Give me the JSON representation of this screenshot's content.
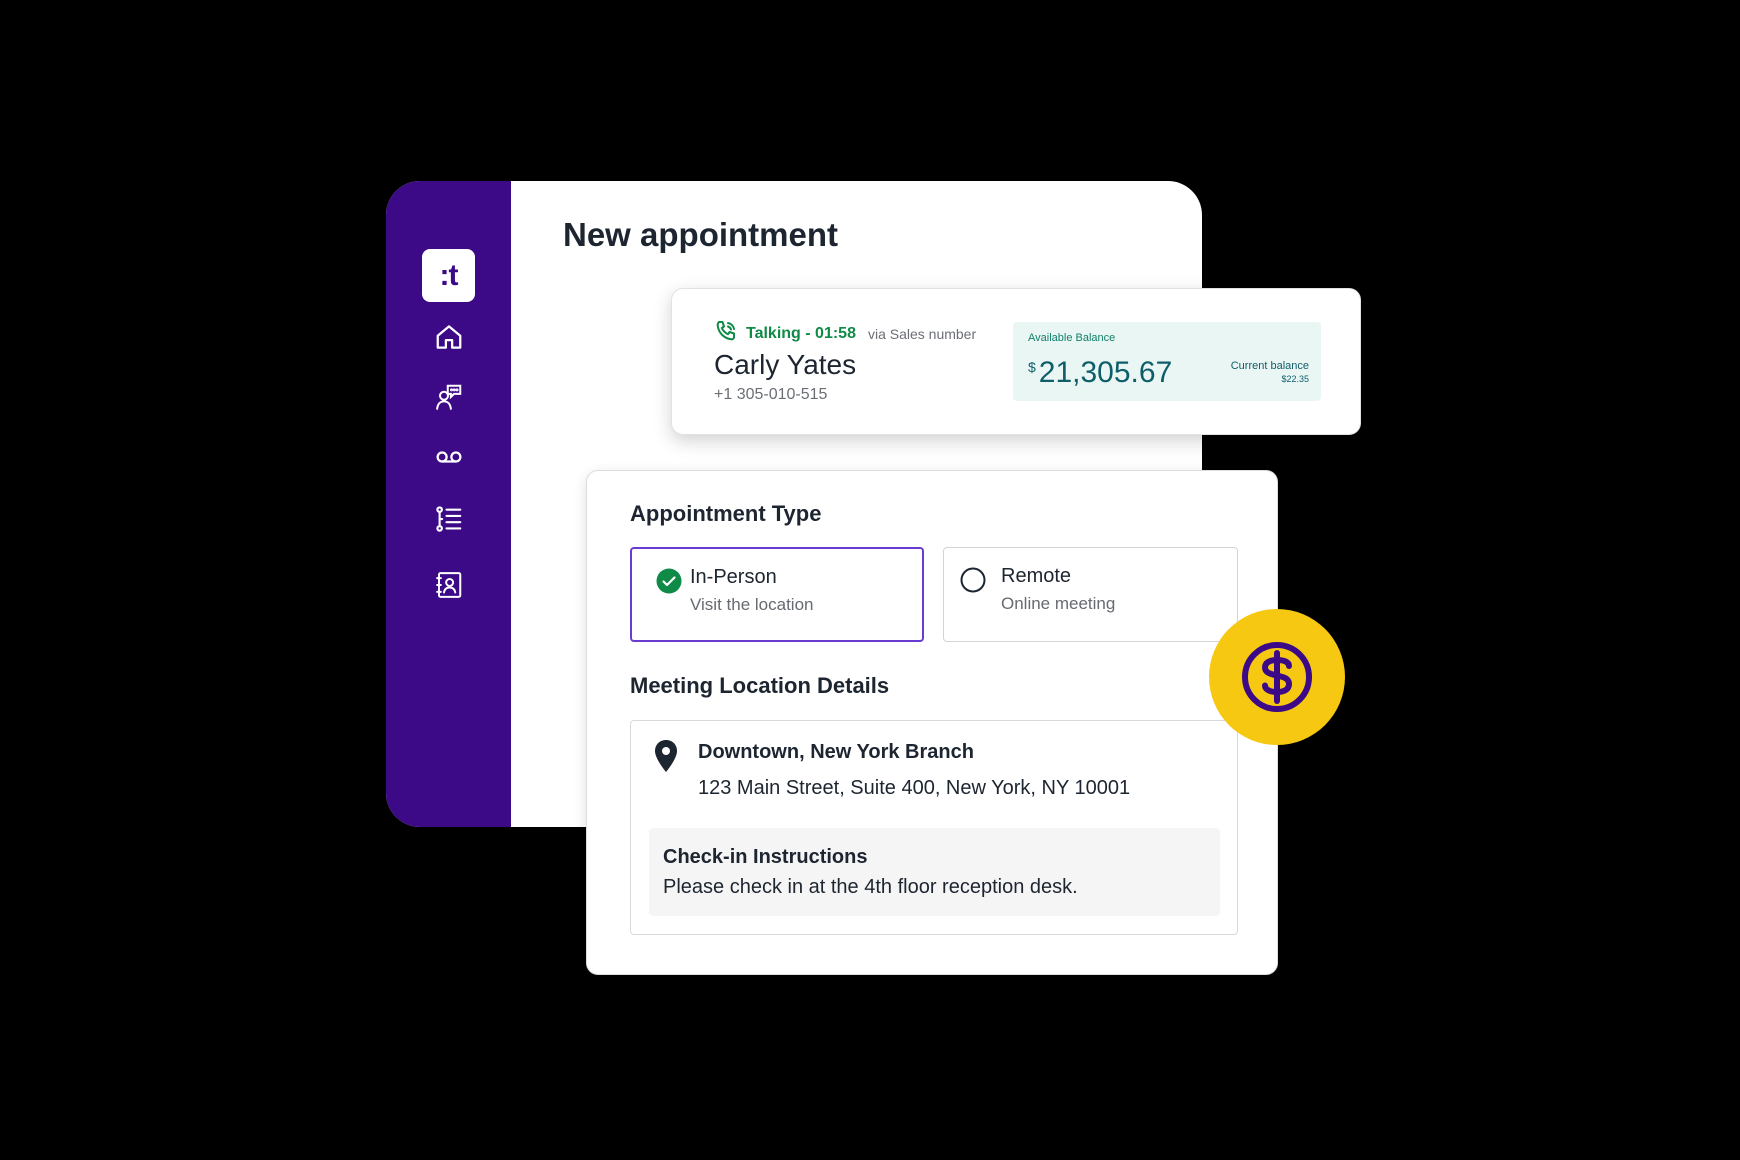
{
  "app": {
    "logo_text": ":t",
    "page_title": "New appointment",
    "nav_icons": [
      "home-icon",
      "contacts-chat-icon",
      "voicemail-icon",
      "list-icon",
      "address-book-icon"
    ]
  },
  "call": {
    "status": "Talking - 01:58",
    "via": "via Sales number",
    "caller_name": "Carly Yates",
    "caller_phone": "+1 305-010-515",
    "balance": {
      "label": "Available Balance",
      "currency": "$",
      "amount": "21,305.67",
      "current_label": "Current balance",
      "current_value": "$22.35"
    }
  },
  "appointment": {
    "type_title": "Appointment Type",
    "options": [
      {
        "title": "In-Person",
        "subtitle": "Visit the location",
        "selected": true
      },
      {
        "title": "Remote",
        "subtitle": "Online meeting",
        "selected": false
      }
    ],
    "location_title": "Meeting Location Details",
    "location": {
      "branch": "Downtown, New York Branch",
      "address": "123 Main Street, Suite 400, New York, NY 10001",
      "checkin_title": "Check-in Instructions",
      "checkin_text": "Please check in at the 4th floor reception desk."
    }
  },
  "colors": {
    "sidebar": "#3c0a87",
    "accent": "#6a3bd0",
    "talking_green": "#0f8a47",
    "balance_bg": "#eaf6f4",
    "badge_yellow": "#f6c812"
  }
}
